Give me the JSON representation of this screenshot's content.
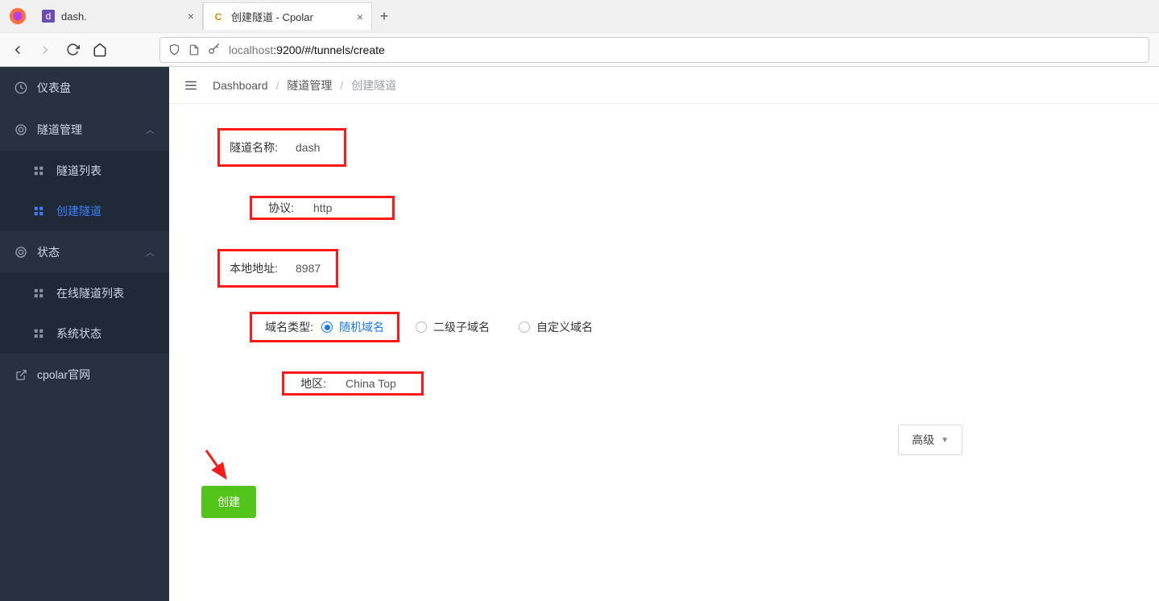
{
  "browser": {
    "tabs": [
      {
        "title": "dash.",
        "favicon_letter": "d",
        "favicon_bg": "#6a4fb1",
        "active": false
      },
      {
        "title": "创建隧道 - Cpolar",
        "favicon_letter": "C",
        "favicon_bg": "#ffffff",
        "favicon_color": "#e28b00",
        "active": true
      }
    ],
    "url_prefix": "localhost",
    "url_path": ":9200/#/tunnels/create"
  },
  "sidebar": {
    "items": [
      {
        "kind": "section",
        "label": "仪表盘",
        "icon": "gauge-icon"
      },
      {
        "kind": "section",
        "label": "隧道管理",
        "icon": "target-icon",
        "expanded": true
      },
      {
        "kind": "sub",
        "label": "隧道列表",
        "icon": "grid-icon"
      },
      {
        "kind": "sub",
        "label": "创建隧道",
        "icon": "grid-icon",
        "active": true
      },
      {
        "kind": "section",
        "label": "状态",
        "icon": "target-icon",
        "expanded": true
      },
      {
        "kind": "sub",
        "label": "在线隧道列表",
        "icon": "grid-icon"
      },
      {
        "kind": "sub",
        "label": "系统状态",
        "icon": "grid-icon"
      },
      {
        "kind": "section",
        "label": "cpolar官网",
        "icon": "external-icon"
      }
    ]
  },
  "breadcrumb": {
    "items": [
      "Dashboard",
      "隧道管理",
      "创建隧道"
    ]
  },
  "form": {
    "name_label": "隧道名称:",
    "name_value": "dash",
    "protocol_label": "协议:",
    "protocol_value": "http",
    "local_addr_label": "本地地址:",
    "local_addr_value": "8987",
    "domain_type_label": "域名类型:",
    "domain_options": [
      "随机域名",
      "二级子域名",
      "自定义域名"
    ],
    "domain_selected_index": 0,
    "region_label": "地区:",
    "region_value": "China Top",
    "advanced_label": "高级",
    "create_label": "创建"
  }
}
